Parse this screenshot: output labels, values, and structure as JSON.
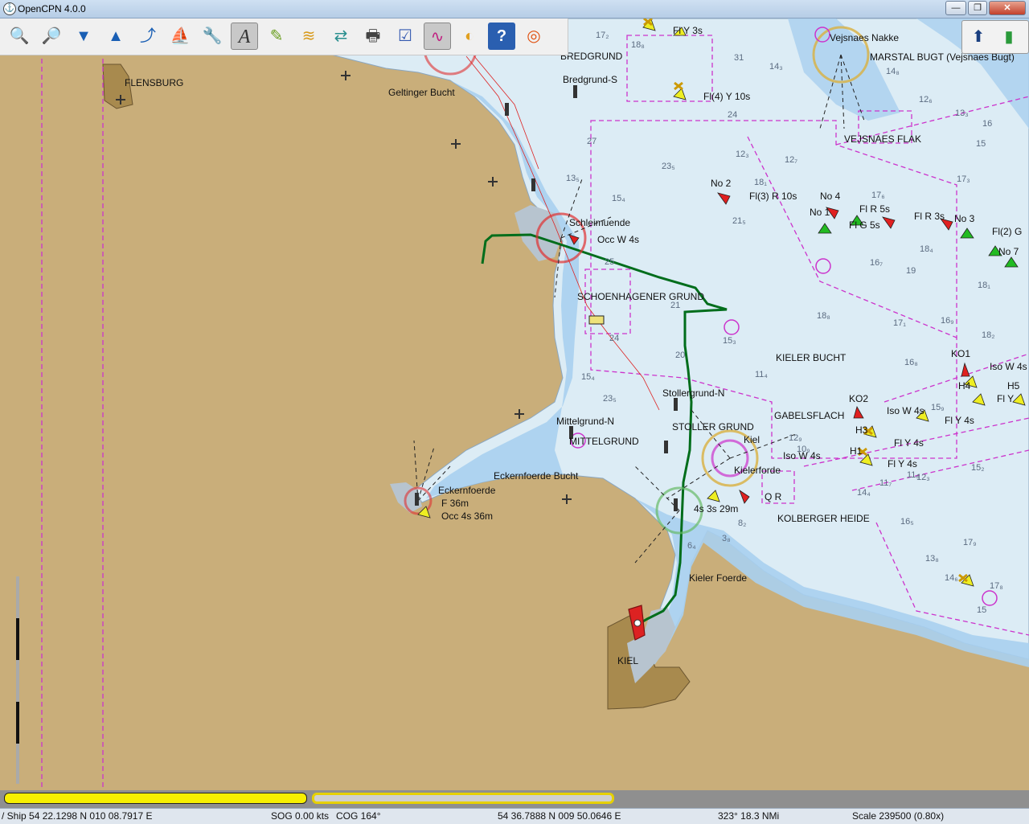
{
  "window": {
    "title": "OpenCPN 4.0.0",
    "minimize": "—",
    "maximize": "❐",
    "close": "✕"
  },
  "toolbar": {
    "items": [
      {
        "name": "zoom-in",
        "glyph": "🔍"
      },
      {
        "name": "zoom-out",
        "glyph": "🔎"
      },
      {
        "name": "scale-down",
        "glyph": "▼"
      },
      {
        "name": "scale-up",
        "glyph": "▲"
      },
      {
        "name": "create-route",
        "glyph": "⤴"
      },
      {
        "name": "auto-follow",
        "glyph": "⛵"
      },
      {
        "name": "settings",
        "glyph": "🔧"
      },
      {
        "name": "text",
        "glyph": "A"
      },
      {
        "name": "mark",
        "glyph": "✎"
      },
      {
        "name": "tides",
        "glyph": "≋"
      },
      {
        "name": "currents",
        "glyph": "⇄"
      },
      {
        "name": "print",
        "glyph": "🖶"
      },
      {
        "name": "route-manager",
        "glyph": "☑"
      },
      {
        "name": "track",
        "glyph": "∿"
      },
      {
        "name": "color-scheme",
        "glyph": "◐"
      },
      {
        "name": "help",
        "glyph": "?"
      },
      {
        "name": "mob",
        "glyph": "◎"
      }
    ]
  },
  "compass": {
    "north": "⬆",
    "signal": "▮"
  },
  "chart_labels": {
    "flensburg": "FLENSBURG",
    "geltinger": "Geltinger Bucht",
    "bredgrund": "BREDGRUND",
    "bredgrund_s": "Bredgrund-S",
    "fly3s": "Fl Y 3s",
    "fl4y10s": "Fl(4) Y 10s",
    "vejsnaes_nakke": "Vejsnaes Nakke",
    "marstal": "MARSTAL BUGT (Vejsnaes Bugt)",
    "vejsnaes_flak": "VEJSNAES FLAK",
    "no2": "No 2",
    "fl3r10s": "Fl(3) R 10s",
    "no4": "No 4",
    "no1": "No 1",
    "flr5s": "Fl R 5s",
    "flg5s": "Fl G 5s",
    "flr3s": "Fl R 3s",
    "no3": "No 3",
    "fl2g": "Fl(2) G",
    "no7": "No 7",
    "schleimuende": "Schleimuende",
    "occw4s": "Occ W 4s",
    "schoenhagener": "SCHOENHAGENER GRUND",
    "kieler_bucht": "KIELER BUCHT",
    "ko1": "KO1",
    "isow4s_a": "Iso W 4s",
    "h4": "H4",
    "h5": "H5",
    "fly_a": "Fl Y",
    "stollergrund_n": "Stollergrund-N",
    "ko2": "KO2",
    "isow4s_b": "Iso W 4s",
    "fly4s_a": "Fl Y 4s",
    "mittelgrund_n": "Mittelgrund-N",
    "mittelgrund": "MITTELGRUND",
    "stoller_grund": "STOLLER GRUND",
    "gabelsflach": "GABELSFLACH",
    "kiel_light": "Kiel",
    "h3": "H3",
    "fly4s_b": "Fl Y 4s",
    "h1": "H1",
    "isow4s_c": "Iso W 4s",
    "fly4s_c": "Fl Y 4s",
    "kieler_foerde_light": "Kielerforde",
    "eckernfoerde_bucht": "Eckernfoerde Bucht",
    "eckernfoerde": "Eckernfoerde",
    "f36m": "F 36m",
    "occ4s36m": "Occ 4s 36m",
    "bulk_light": "4s 3s 29m",
    "qr": "Q R",
    "kolberger": "KOLBERGER HEIDE",
    "kieler_foerde": "Kieler Foerde",
    "kiel": "KIEL"
  },
  "soundings": [
    "17₂",
    "18₈",
    "31",
    "14₃",
    "14₈",
    "12₆",
    "13₃",
    "16",
    "15",
    "24",
    "12₃",
    "12₇",
    "23₅",
    "18₁",
    "15₄",
    "17₆",
    "18₄",
    "21₅",
    "16₇",
    "19",
    "20",
    "18₈",
    "17₁",
    "15₃",
    "11₄",
    "16₈",
    "23₅",
    "15₄",
    "12₉",
    "11₇",
    "15₉",
    "11₆",
    "12₃",
    "14₄",
    "16₅",
    "17₉",
    "13₈",
    "14₆",
    "17₈",
    "15₂",
    "18₂",
    "17₃",
    "25",
    "27",
    "13₅",
    "15",
    "10₉",
    "8₂",
    "6₄",
    "3₈",
    "21",
    "24",
    "18₁",
    "16₉"
  ],
  "statusbar": {
    "ship": "/ Ship 54 22.1298 N   010 08.7917 E",
    "sog": "SOG 0.00 kts",
    "cog": "COG 164°",
    "cursor": "54 36.7888 N   009 50.0646 E",
    "bearing": "323°  18.3 NMi",
    "scale": "Scale 239500 (0.80x)"
  },
  "colors": {
    "land": "#c9ae7a",
    "shallow": "#a9d0ef",
    "deep": "#dcecf5",
    "track": "#006d1b",
    "boundary": "#cc33cc",
    "buoy_red": "#e02020",
    "buoy_green": "#22bb22",
    "buoy_yellow": "#eeee22",
    "ship": "#dd2222"
  }
}
